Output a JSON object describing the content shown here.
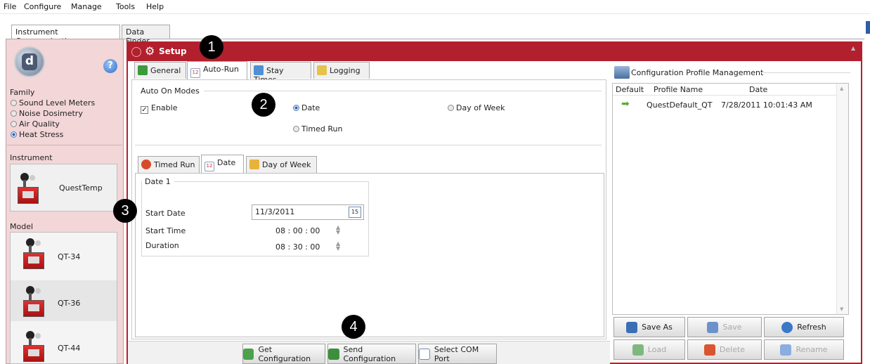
{
  "menu": [
    "File",
    "Configure",
    "Manage",
    "Tools",
    "Help"
  ],
  "outer_tabs": [
    "Instrument Communications",
    "Data Finder"
  ],
  "left": {
    "help_glyph": "?",
    "logo_glyph": "d",
    "family_label": "Family",
    "family_options": [
      "Sound Level Meters",
      "Noise Dosimetry",
      "Air Quality",
      "Heat Stress"
    ],
    "family_selected": "Heat Stress",
    "instrument_label": "Instrument",
    "instrument_name": "QuestTemp",
    "model_label": "Model",
    "models": [
      "QT-34",
      "QT-36",
      "QT-44"
    ],
    "model_selected": "QT-36"
  },
  "setup": {
    "title": "Setup",
    "tabs": [
      "General",
      "Auto-Run",
      "Stay Times",
      "Logging"
    ],
    "active_tab": "Auto-Run",
    "auto_on_modes_label": "Auto On Modes",
    "enable_label": "Enable",
    "enable_checked": true,
    "mode_options": [
      "Date",
      "Day of Week",
      "Timed Run"
    ],
    "mode_selected": "Date",
    "sub_tabs": [
      "Timed Run",
      "Date",
      "Day of Week"
    ],
    "sub_active": "Date",
    "date_group": "Date 1",
    "start_date_label": "Start Date",
    "start_date_value": "11/3/2011",
    "calendar_day": "15",
    "start_time_label": "Start Time",
    "start_time_value": "08 : 00 : 00",
    "duration_label": "Duration",
    "duration_value": "08 : 30 : 00"
  },
  "bottom_buttons": [
    "Get Configuration",
    "Send Configuration",
    "Select COM Port"
  ],
  "profiles": {
    "header": "Configuration Profile Management",
    "columns": [
      "Default",
      "Profile Name",
      "Date"
    ],
    "rows": [
      {
        "name": "QuestDefault_QT",
        "date": "7/28/2011 10:01:43 AM"
      }
    ],
    "buttons": {
      "save_as": "Save As",
      "save": "Save",
      "refresh": "Refresh",
      "load": "Load",
      "delete": "Delete",
      "rename": "Rename"
    }
  },
  "callouts": [
    "1",
    "2",
    "3",
    "4"
  ],
  "colors": {
    "accent": "#b21f2d",
    "left_panel": "#f3d6d8"
  }
}
